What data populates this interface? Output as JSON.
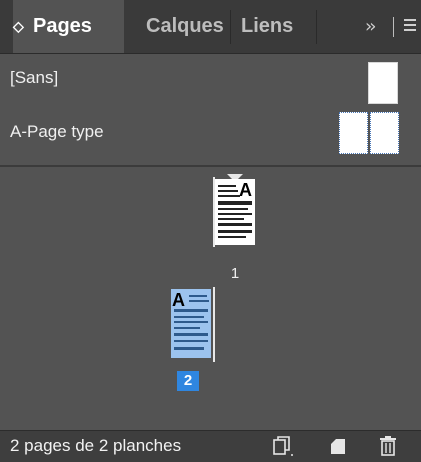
{
  "tabs": [
    {
      "label": "Pages",
      "active": true
    },
    {
      "label": "Calques",
      "active": false
    },
    {
      "label": "Liens",
      "active": false
    }
  ],
  "tabbar": {
    "collapse_glyph": "◇",
    "overflow_glyph": "›› "
  },
  "masters": [
    {
      "label": "[Sans]"
    },
    {
      "label": "A-Page type"
    }
  ],
  "pages": [
    {
      "number": "1",
      "master_prefix": "A",
      "selected": false
    },
    {
      "number": "2",
      "master_prefix": "A",
      "selected": true
    }
  ],
  "footer": {
    "status": "2 pages de 2 planches",
    "icons": [
      "page-size-icon",
      "new-page-icon",
      "trash-icon"
    ]
  },
  "colors": {
    "panel_bg": "#535353",
    "tabbar_bg": "#3a3a3a",
    "selection_blue": "#2f86e0",
    "selected_page_fill": "#9cc3ee"
  }
}
